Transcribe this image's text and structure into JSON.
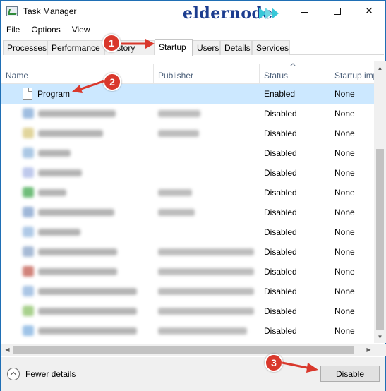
{
  "window": {
    "title": "Task Manager",
    "watermark": "eldernode",
    "accent_color": "#1f6fb5"
  },
  "menu": [
    "File",
    "Options",
    "View"
  ],
  "tabs": [
    {
      "label": "Processes"
    },
    {
      "label": "Performance"
    },
    {
      "label": "History"
    },
    {
      "label": "Startup",
      "active": true
    },
    {
      "label": "Users"
    },
    {
      "label": "Details"
    },
    {
      "label": "Services"
    }
  ],
  "columns": {
    "name": "Name",
    "publisher": "Publisher",
    "status": "Status",
    "impact": "Startup impact"
  },
  "rows": [
    {
      "name": "Program",
      "publisher": "",
      "status": "Enabled",
      "impact": "None",
      "selected": true,
      "blurred": false
    },
    {
      "status": "Disabled",
      "impact": "None",
      "blurred": true
    },
    {
      "status": "Disabled",
      "impact": "None",
      "blurred": true
    },
    {
      "status": "Disabled",
      "impact": "None",
      "blurred": true
    },
    {
      "status": "Disabled",
      "impact": "None",
      "blurred": true
    },
    {
      "status": "Disabled",
      "impact": "None",
      "blurred": true
    },
    {
      "status": "Disabled",
      "impact": "None",
      "blurred": true
    },
    {
      "status": "Disabled",
      "impact": "None",
      "blurred": true
    },
    {
      "status": "Disabled",
      "impact": "None",
      "blurred": true
    },
    {
      "status": "Disabled",
      "impact": "None",
      "blurred": true
    },
    {
      "status": "Disabled",
      "impact": "None",
      "blurred": true
    },
    {
      "status": "Disabled",
      "impact": "None",
      "blurred": true
    },
    {
      "status": "Disabled",
      "impact": "None",
      "blurred": true
    }
  ],
  "footer": {
    "fewer_details": "Fewer details",
    "disable_button": "Disable"
  },
  "callouts": [
    "1",
    "2",
    "3"
  ],
  "callout_color": "#d9382c",
  "selection_color": "#cce8ff"
}
